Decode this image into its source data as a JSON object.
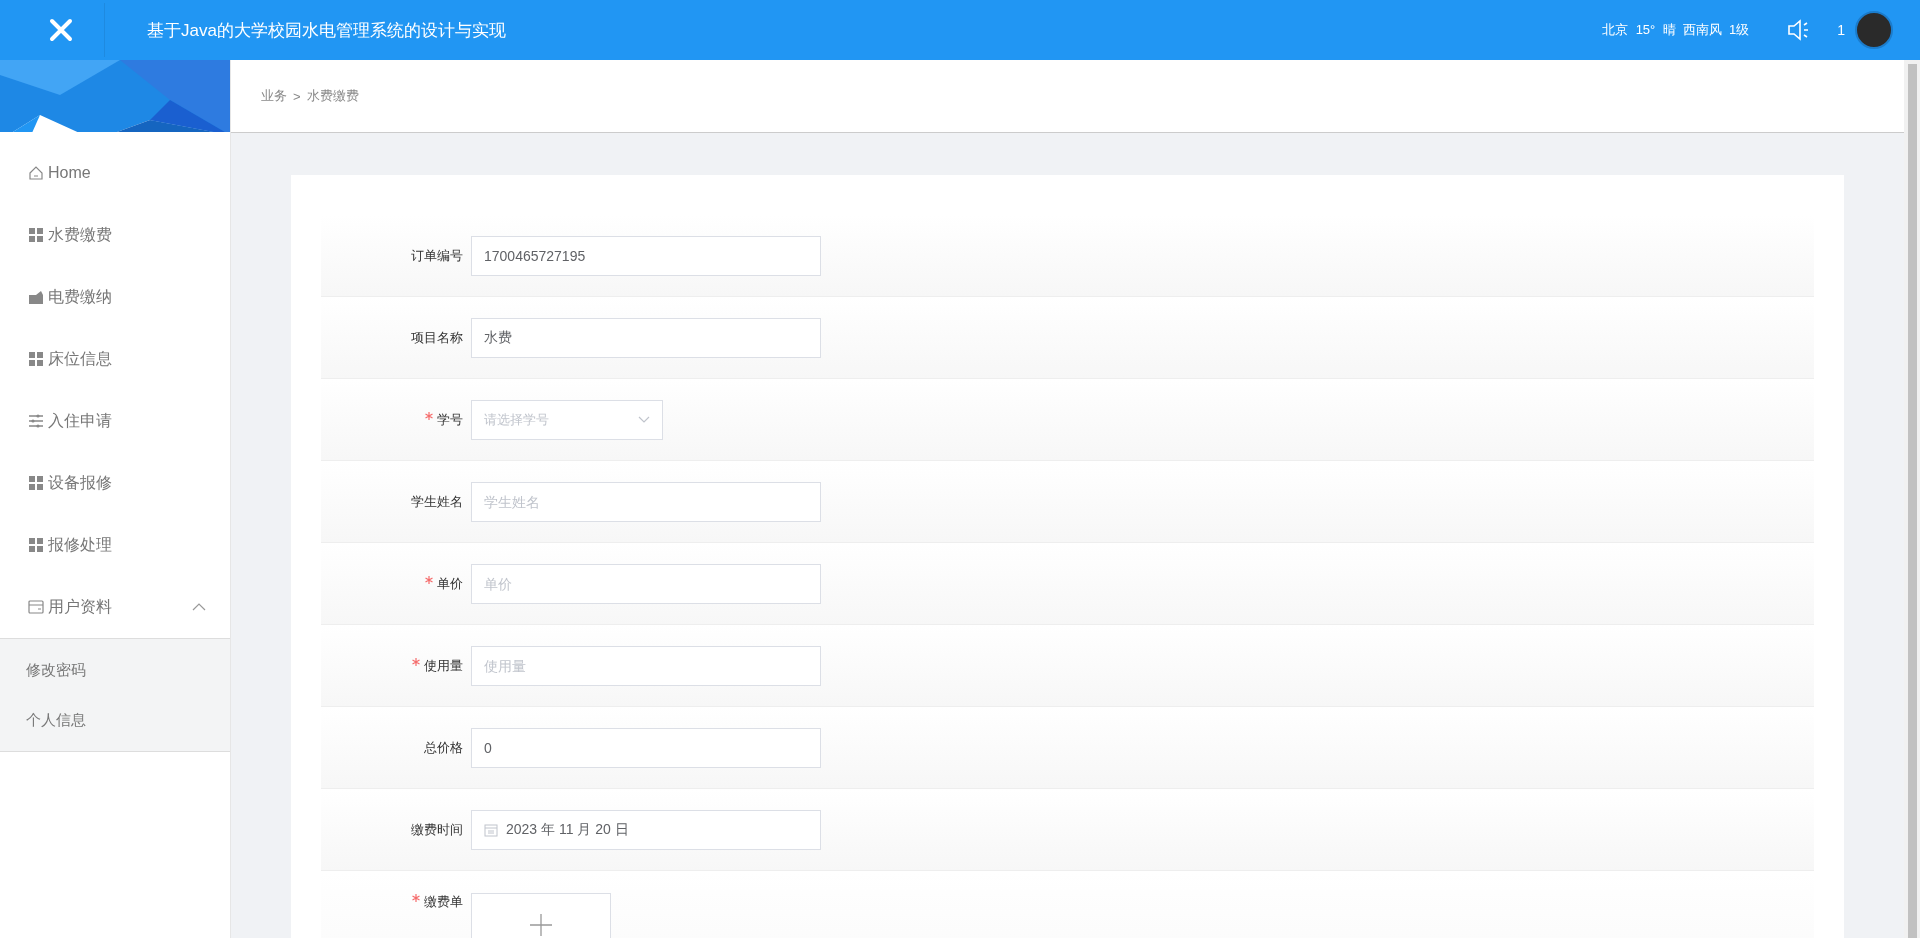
{
  "header": {
    "title": "基于Java的大学校园水电管理系统的设计与实现",
    "weather": "北京  15°  晴  西南风  1级",
    "notice_count": "1"
  },
  "sidebar": {
    "items": [
      {
        "label": "Home",
        "selected": false
      },
      {
        "label": "水费缴费",
        "selected": false
      },
      {
        "label": "电费缴纳",
        "selected": false
      },
      {
        "label": "床位信息",
        "selected": false
      },
      {
        "label": "入住申请",
        "selected": false
      },
      {
        "label": "设备报修",
        "selected": false
      },
      {
        "label": "报修处理",
        "selected": false
      },
      {
        "label": "用户资料",
        "selected": false,
        "expanded": true,
        "children": [
          {
            "label": "修改密码",
            "selected": false
          },
          {
            "label": "个人信息",
            "selected": false
          }
        ]
      }
    ]
  },
  "breadcrumb": {
    "items": [
      "业务",
      "水费缴费"
    ],
    "separator": ">"
  },
  "form": {
    "fields": [
      {
        "kind": "input",
        "label": "订单编号",
        "required": false,
        "value": "1700465727195"
      },
      {
        "kind": "input",
        "label": "项目名称",
        "required": false,
        "value": "水费"
      },
      {
        "kind": "select",
        "label": "学号",
        "required": true,
        "placeholder": "请选择学号"
      },
      {
        "kind": "input",
        "label": "学生姓名",
        "required": false,
        "placeholder": "学生姓名"
      },
      {
        "kind": "input",
        "label": "单价",
        "required": true,
        "placeholder": "单价"
      },
      {
        "kind": "input",
        "label": "使用量",
        "required": true,
        "placeholder": "使用量"
      },
      {
        "kind": "input",
        "label": "总价格",
        "required": false,
        "value": "0"
      },
      {
        "kind": "date",
        "label": "缴费时间",
        "required": false,
        "value": "2023 年 11 月 20 日"
      },
      {
        "kind": "upload",
        "label": "缴费单",
        "required": true
      }
    ]
  }
}
